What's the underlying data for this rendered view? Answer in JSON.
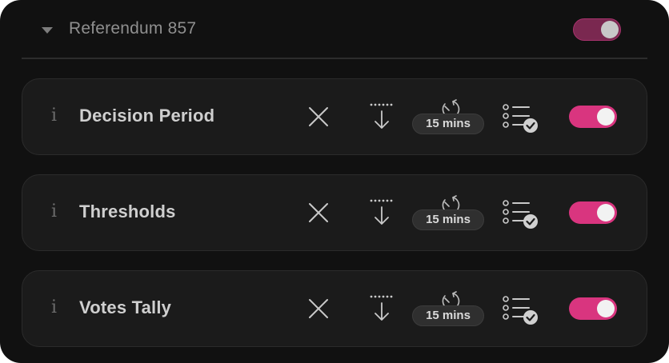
{
  "header": {
    "title": "Referendum 857",
    "toggle_on": true
  },
  "cards": [
    {
      "title": "Decision Period",
      "duration": "15 mins",
      "toggle_on": true
    },
    {
      "title": "Thresholds",
      "duration": "15 mins",
      "toggle_on": true
    },
    {
      "title": "Votes Tally",
      "duration": "15 mins",
      "toggle_on": true
    }
  ],
  "icons": {
    "info": "i",
    "header_caret": "caret-down-icon",
    "remove": "close-icon",
    "move_down": "arrow-down-to-line-icon",
    "timer": "timer-icon",
    "checklist": "checklist-icon"
  },
  "colors": {
    "panel_bg": "#111111",
    "card_bg": "#1b1b1b",
    "toggle_on": "#d9357f",
    "header_toggle": "#7a2850"
  }
}
